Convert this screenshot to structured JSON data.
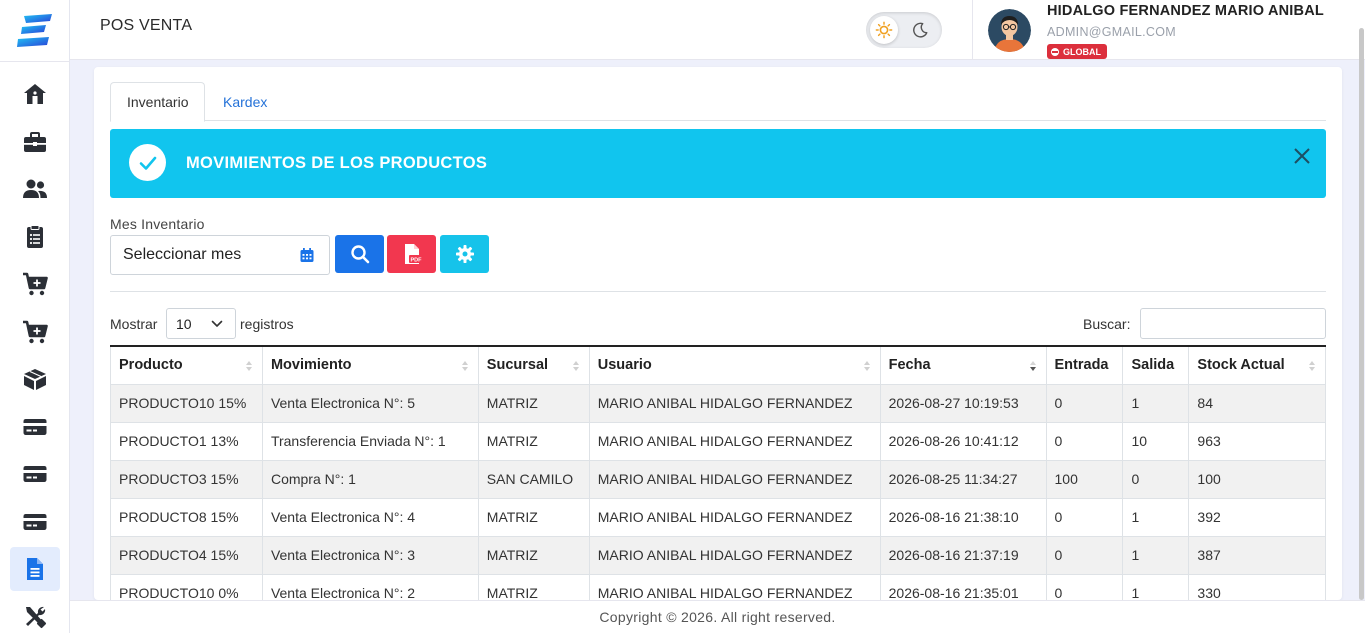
{
  "header": {
    "title": "POS VENTA",
    "user_name": "HIDALGO FERNANDEZ MARIO ANIBAL",
    "user_email": "ADMIN@GMAIL.COM",
    "user_badge": "GLOBAL"
  },
  "sidebar": {
    "icons": [
      "home-icon",
      "briefcase-icon",
      "users-icon",
      "clipboard-icon",
      "cart-plus-icon",
      "cart-plus-icon",
      "box-icon",
      "card-icon",
      "card-icon",
      "card-icon",
      "file-icon",
      "tools-icon"
    ],
    "active_index": 10
  },
  "tabs": [
    {
      "label": "Inventario",
      "active": true
    },
    {
      "label": "Kardex",
      "active": false
    }
  ],
  "banner": {
    "title": "MOVIMIENTOS DE LOS PRODUCTOS"
  },
  "filters": {
    "mes_label": "Mes Inventario",
    "mes_placeholder": "Seleccionar mes"
  },
  "table_controls": {
    "show_label": "Mostrar",
    "show_value": "10",
    "show_after": "registros",
    "search_label": "Buscar:"
  },
  "table": {
    "columns": [
      "Producto",
      "Movimiento",
      "Sucursal",
      "Usuario",
      "Fecha",
      "Entrada",
      "Salida",
      "Stock Actual"
    ],
    "rows": [
      [
        "PRODUCTO10 15%",
        "Venta Electronica N°: 5",
        "MATRIZ",
        "MARIO ANIBAL HIDALGO FERNANDEZ",
        "2026-08-27 10:19:53",
        "0",
        "1",
        "84"
      ],
      [
        "PRODUCTO1 13%",
        "Transferencia Enviada N°: 1",
        "MATRIZ",
        "MARIO ANIBAL HIDALGO FERNANDEZ",
        "2026-08-26 10:41:12",
        "0",
        "10",
        "963"
      ],
      [
        "PRODUCTO3 15%",
        "Compra N°: 1",
        "SAN CAMILO",
        "MARIO ANIBAL HIDALGO FERNANDEZ",
        "2026-08-25 11:34:27",
        "100",
        "0",
        "100"
      ],
      [
        "PRODUCTO8 15%",
        "Venta Electronica N°: 4",
        "MATRIZ",
        "MARIO ANIBAL HIDALGO FERNANDEZ",
        "2026-08-16 21:38:10",
        "0",
        "1",
        "392"
      ],
      [
        "PRODUCTO4 15%",
        "Venta Electronica N°: 3",
        "MATRIZ",
        "MARIO ANIBAL HIDALGO FERNANDEZ",
        "2026-08-16 21:37:19",
        "0",
        "1",
        "387"
      ],
      [
        "PRODUCTO10 0%",
        "Venta Electronica N°: 2",
        "MATRIZ",
        "MARIO ANIBAL HIDALGO FERNANDEZ",
        "2026-08-16 21:35:01",
        "0",
        "1",
        "330"
      ]
    ]
  },
  "footer": {
    "copyright": "Copyright © 2026. All right reserved."
  },
  "colors": {
    "primary": "#1a73e8",
    "banner": "#11c5ee",
    "danger": "#f2374f",
    "sidebar_icon": "#2b2f36"
  }
}
